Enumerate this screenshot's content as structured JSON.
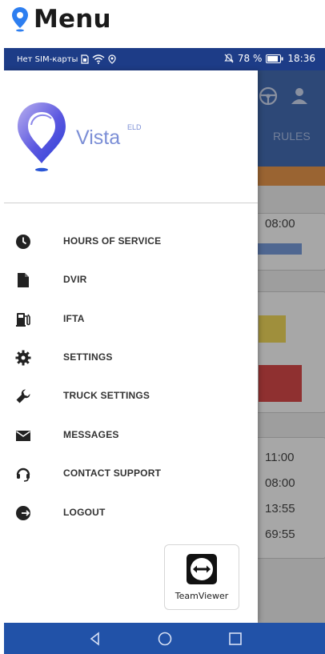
{
  "header": {
    "title": "Menu",
    "icon": "location-pin-icon",
    "accent": "#2d7ef0"
  },
  "statusbar": {
    "carrier": "Нет SIM-карты",
    "battery": "78 %",
    "time": "18:36",
    "bg_color": "#1d3c87"
  },
  "background_app": {
    "tab_label": "RULES",
    "times": [
      "08:00",
      "11:00",
      "08:00",
      "13:55",
      "69:55"
    ],
    "appbar_color": "#2152a8",
    "orange": "#e7852b"
  },
  "brand": {
    "name": "Vista",
    "superscript": "ELD"
  },
  "menu": {
    "items": [
      {
        "label": "HOURS OF SERVICE",
        "icon": "clock-icon"
      },
      {
        "label": "DVIR",
        "icon": "document-icon"
      },
      {
        "label": "IFTA",
        "icon": "fuel-pump-icon"
      },
      {
        "label": "SETTINGS",
        "icon": "gear-icon"
      },
      {
        "label": "TRUCK SETTINGS",
        "icon": "wrench-icon"
      },
      {
        "label": "MESSAGES",
        "icon": "envelope-icon"
      },
      {
        "label": "CONTACT SUPPORT",
        "icon": "headset-icon"
      },
      {
        "label": "LOGOUT",
        "icon": "logout-icon"
      }
    ]
  },
  "teamviewer": {
    "label": "TeamViewer",
    "icon": "teamviewer-icon"
  },
  "navbar": {
    "color": "#2152a8",
    "buttons": [
      "back-icon",
      "home-icon",
      "recents-icon"
    ]
  }
}
